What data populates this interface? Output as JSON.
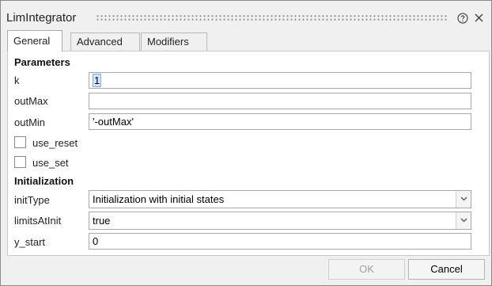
{
  "window": {
    "title": "LimIntegrator"
  },
  "tabs": [
    {
      "label": "General"
    },
    {
      "label": "Advanced"
    },
    {
      "label": "Modifiers"
    }
  ],
  "parameters": {
    "heading": "Parameters",
    "k": {
      "label": "k",
      "value": "1"
    },
    "outMax": {
      "label": "outMax",
      "value": ""
    },
    "outMin": {
      "label": "outMin",
      "value": "'-outMax'"
    },
    "use_reset": {
      "label": "use_reset",
      "checked": false
    },
    "use_set": {
      "label": "use_set",
      "checked": false
    }
  },
  "initialization": {
    "heading": "Initialization",
    "initType": {
      "label": "initType",
      "value": "Initialization with initial states"
    },
    "limitsAtInit": {
      "label": "limitsAtInit",
      "value": "true"
    },
    "y_start": {
      "label": "y_start",
      "value": "0"
    }
  },
  "buttons": {
    "ok": "OK",
    "cancel": "Cancel"
  },
  "icons": {
    "help": "help-icon",
    "close": "close-icon",
    "dropdown": "chevron-down-icon"
  }
}
